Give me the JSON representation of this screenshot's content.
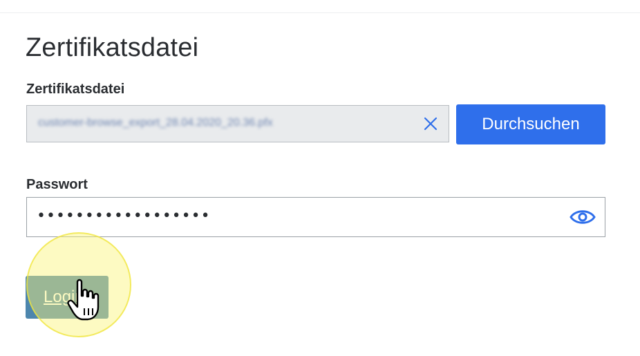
{
  "page": {
    "title": "Zertifikatsdatei"
  },
  "certificate": {
    "label": "Zertifikatsdatei",
    "file_name": "customer-browse_export_28.04.2020_20.36.pfx",
    "browse_label": "Durchsuchen",
    "clear_icon": "close-icon"
  },
  "password": {
    "label": "Passwort",
    "masked_value": "••••••••••••••••••",
    "toggle_icon": "eye-icon"
  },
  "login": {
    "label": "Login"
  },
  "colors": {
    "primary": "#2f6feb",
    "login_pressed": "#4d86ad",
    "click_highlight": "#faf578"
  }
}
